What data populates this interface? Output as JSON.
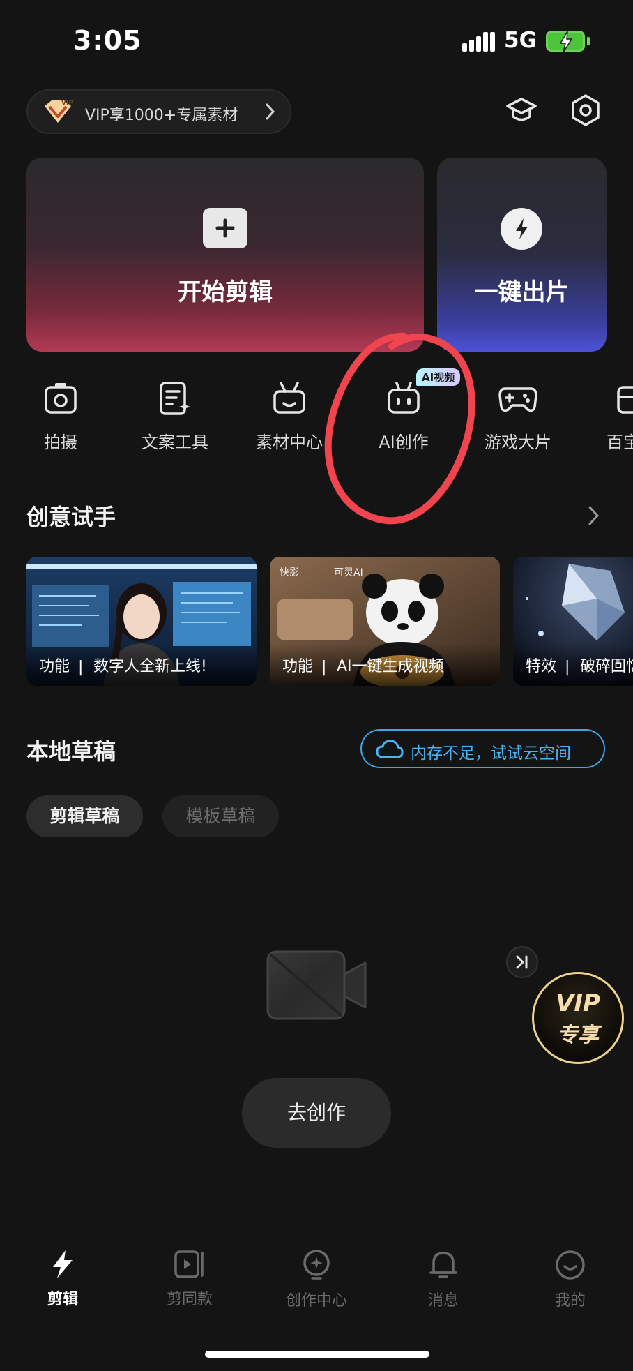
{
  "status_bar": {
    "time": "3:05",
    "network": "5G"
  },
  "vip_promo": {
    "label": "VIP享1000+专属素材"
  },
  "cards": {
    "main_title": "开始剪辑",
    "side_title": "一键出片"
  },
  "tools": [
    {
      "label": "拍摄"
    },
    {
      "label": "文案工具"
    },
    {
      "label": "素材中心"
    },
    {
      "label": "AI创作",
      "badge": "AI视频"
    },
    {
      "label": "游戏大片"
    },
    {
      "label": "百宝"
    }
  ],
  "creative": {
    "title": "创意试手",
    "items": [
      {
        "kind": "功能",
        "text": "数字人全新上线!"
      },
      {
        "kind": "功能",
        "text": "AI一键生成视频",
        "tags": [
          "快影",
          "可灵AI"
        ]
      },
      {
        "kind": "特效",
        "text": "破碎回忆"
      }
    ]
  },
  "drafts": {
    "title": "本地草稿",
    "cloud_label": "内存不足，试试云空间",
    "tabs": [
      "剪辑草稿",
      "模板草稿"
    ],
    "go_create": "去创作"
  },
  "vip_float": {
    "line1": "VIP",
    "line2": "专享"
  },
  "bottom_nav": [
    {
      "label": "剪辑",
      "active": true
    },
    {
      "label": "剪同款"
    },
    {
      "label": "创作中心"
    },
    {
      "label": "消息"
    },
    {
      "label": "我的"
    }
  ],
  "colors": {
    "accent_blue": "#3aa7e8",
    "annotation_red": "#f0444f",
    "battery": "#4cc53a"
  }
}
